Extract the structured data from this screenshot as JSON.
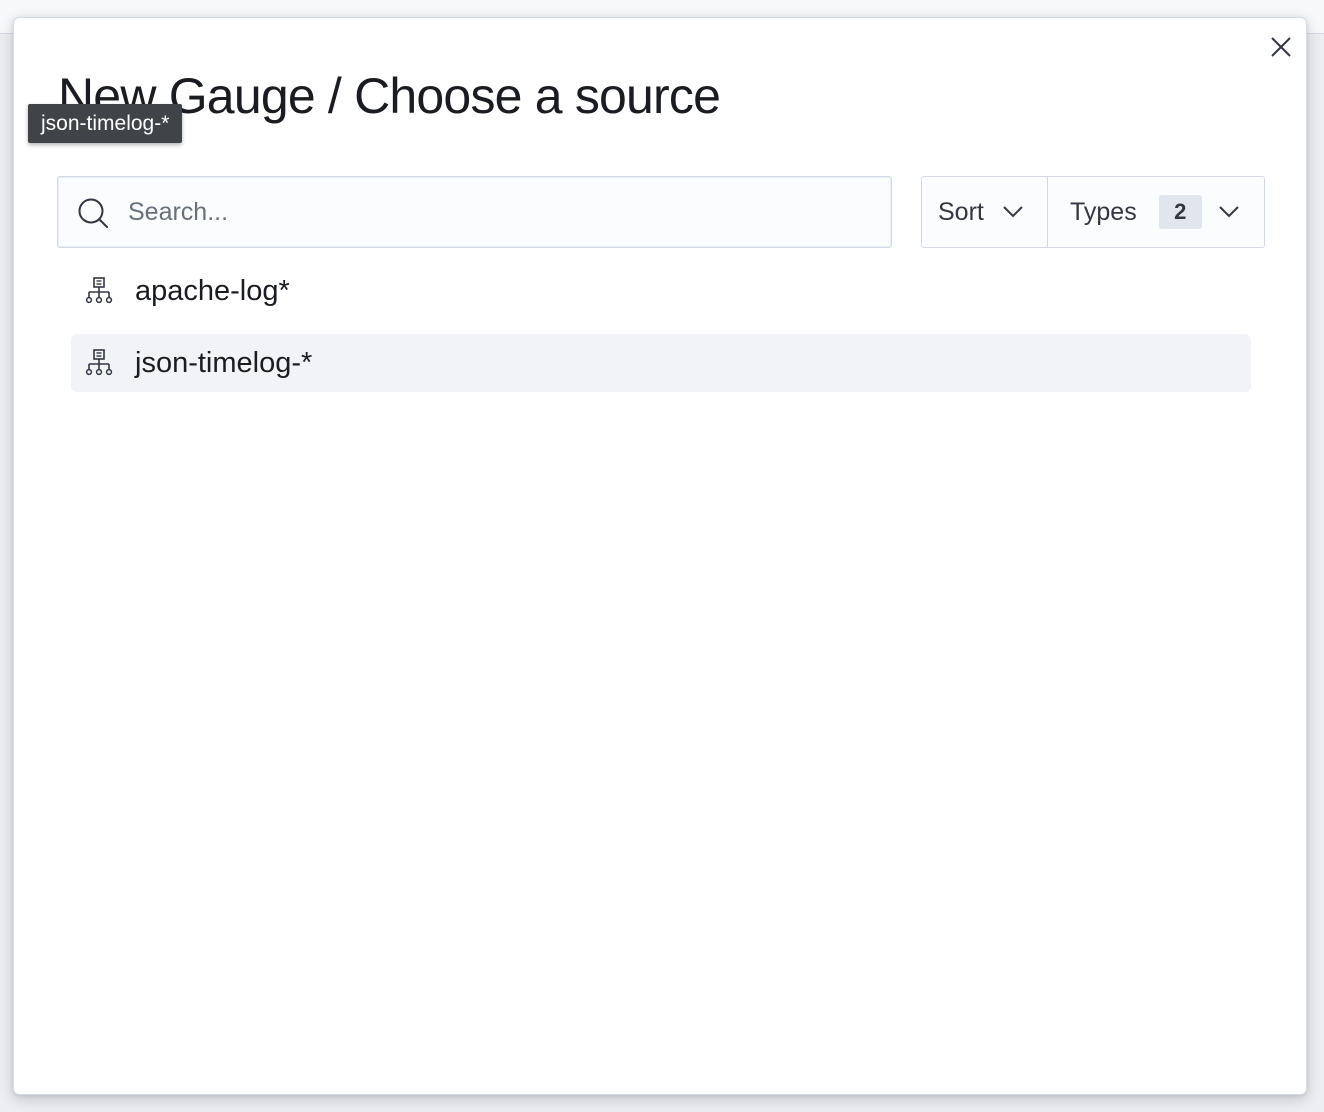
{
  "modal": {
    "title": "New Gauge / Choose a source",
    "close_icon": "close-icon"
  },
  "tooltip": {
    "text": "json-timelog-*"
  },
  "search": {
    "placeholder": "Search...",
    "value": "",
    "icon": "search-icon"
  },
  "filters": {
    "sort_label": "Sort",
    "types_label": "Types",
    "types_count": "2",
    "chevron_icon": "chevron-down-icon"
  },
  "sources": [
    {
      "label": "apache-log*",
      "icon": "index-pattern-icon",
      "highlighted": false
    },
    {
      "label": "json-timelog-*",
      "icon": "index-pattern-icon",
      "highlighted": true
    }
  ],
  "colors": {
    "highlight_background": "#f1f3f7",
    "tooltip_background": "#404347",
    "badge_background": "#e0e5ee",
    "border": "#d3dae6"
  }
}
